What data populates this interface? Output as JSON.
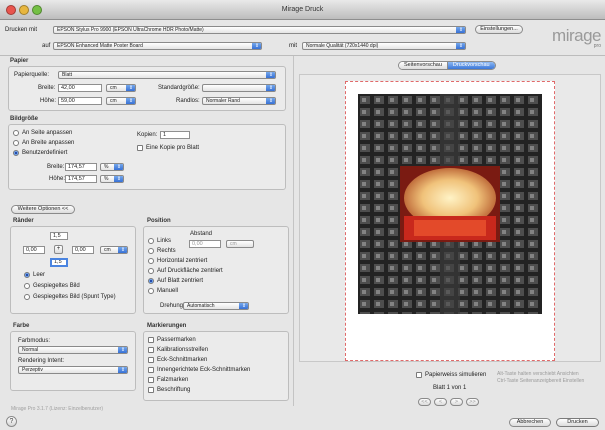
{
  "window": {
    "title": "Mirage Druck"
  },
  "top": {
    "printer_label": "Drucken mit",
    "printer_value": "EPSON Stylus Pro 9900 (EPSON UltraChrome HDR Photo/Matte)",
    "settings_button": "Einstellungen...",
    "media_label": "auf",
    "media_value": "EPSON Enhanced Matte Poster Board",
    "quality_label": "mit",
    "quality_value": "Normale Qualität (720x1440 dpi)",
    "logo": "mirage",
    "logo_sub": "pro"
  },
  "paper": {
    "section": "Papier",
    "source_label": "Papierquelle:",
    "source_value": "Blatt",
    "width_label": "Breite:",
    "width_value": "42,00",
    "height_label": "Höhe:",
    "height_value": "59,00",
    "unit": "cm",
    "std_label": "Standardgröße:",
    "std_value": "",
    "border_label": "Randlos:",
    "border_value": "Normaler Rand"
  },
  "image_size": {
    "section": "Bildgröße",
    "options": [
      "An Seite anpassen",
      "An Breite anpassen",
      "Benutzerdefiniert"
    ],
    "selected": 2,
    "copies_label": "Kopien:",
    "copies_value": "1",
    "one_copy_label": "Eine Kopie pro Blatt",
    "width_label": "Breite:",
    "width_value": "174,57",
    "height_label": "Höhe:",
    "height_value": "174,57",
    "unit": "%"
  },
  "more_options": "Weitere Optionen <<",
  "margins": {
    "section": "Ränder",
    "top": "1,5",
    "left": "0,00",
    "right": "0,00",
    "bottom": "1,5",
    "unit": "cm",
    "modes": [
      "Leer",
      "Gespiegeltes Bild",
      "Gespiegeltes Bild (Spunt Type)"
    ],
    "selected": 0
  },
  "position": {
    "section": "Position",
    "spacing_label": "Abstand",
    "spacing_value": "0,00",
    "spacing_unit": "cm",
    "options": [
      "Links",
      "Rechts",
      "Horizontal zentriert",
      "Auf Druckfläche zentriert",
      "Auf Blatt zentriert",
      "Manuell"
    ],
    "selected": 4,
    "rotation_label": "Drehung:",
    "rotation_value": "Automatisch"
  },
  "color": {
    "section": "Farbe",
    "mode_label": "Farbmodus:",
    "mode_value": "Normal",
    "intent_label": "Rendering Intent:",
    "intent_value": "Perzeptiv"
  },
  "marks": {
    "section": "Markierungen",
    "items": [
      "Passermarken",
      "Kalibrationsstreifen",
      "Eck-Schnittmarken",
      "Innengerichtete Eck-Schnittmarken",
      "Falzmarken",
      "Beschriftung"
    ]
  },
  "preview": {
    "tabs": [
      "Seitenvorschau",
      "Druckvorschau"
    ],
    "active_tab": 1,
    "simulate_label": "Papierweiss simulieren",
    "page_info": "Blatt 1 von 1",
    "warn1": "Alt-Taste halten verschiebt Ansichten",
    "warn2": "Ctrl-Taste Seitenanzeigbereit Einstellen",
    "nav": [
      "<<",
      "<",
      ">",
      ">>"
    ]
  },
  "footer": {
    "version": "Mirage Pro 3.1.7 (Lizenz: Einzelbenutzer)",
    "cancel": "Abbrechen",
    "print": "Drucken"
  },
  "colors": {
    "accent": "#2c67d1",
    "preview_border": "#e06a6a"
  }
}
